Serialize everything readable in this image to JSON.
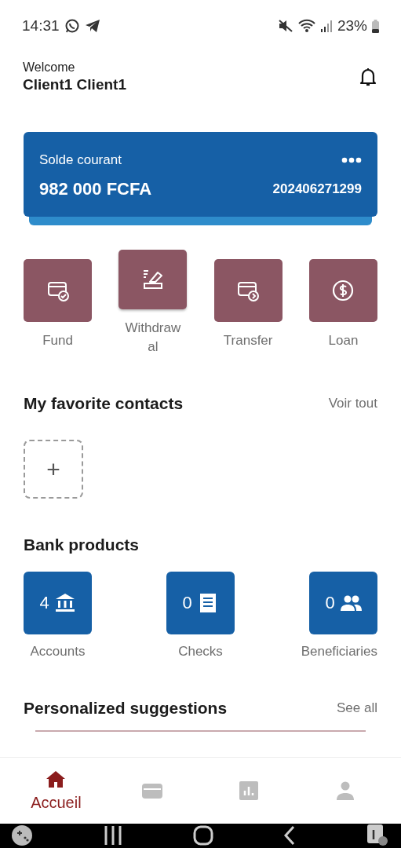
{
  "status_bar": {
    "time": "14:31",
    "battery": "23%"
  },
  "header": {
    "greeting": "Welcome",
    "name": "Client1 Client1"
  },
  "balance_card": {
    "label": "Solde courant",
    "amount": "982 000 FCFA",
    "account_number": "202406271299"
  },
  "actions": [
    {
      "label": "Fund",
      "kind": "card-check",
      "raised": false
    },
    {
      "label": "Withdrawal",
      "kind": "withdraw",
      "raised": true
    },
    {
      "label": "Transfer",
      "kind": "card-arrow",
      "raised": false
    },
    {
      "label": "Loan",
      "kind": "dollar",
      "raised": false
    }
  ],
  "favorites": {
    "title": "My favorite contacts",
    "link": "Voir tout",
    "add": "+"
  },
  "bank_products": {
    "title": "Bank products",
    "items": [
      {
        "count": "4",
        "label": "Accounts",
        "kind": "bank"
      },
      {
        "count": "0",
        "label": "Checks",
        "kind": "receipt"
      },
      {
        "count": "0",
        "label": "Beneficiaries",
        "kind": "people"
      }
    ]
  },
  "suggestions": {
    "title": "Personalized suggestions",
    "link": "See all"
  },
  "bottom_nav": [
    {
      "kind": "home",
      "label": "Accueil",
      "selected": true
    },
    {
      "kind": "card",
      "selected": false
    },
    {
      "kind": "chart",
      "selected": false
    },
    {
      "kind": "person",
      "selected": false
    }
  ]
}
